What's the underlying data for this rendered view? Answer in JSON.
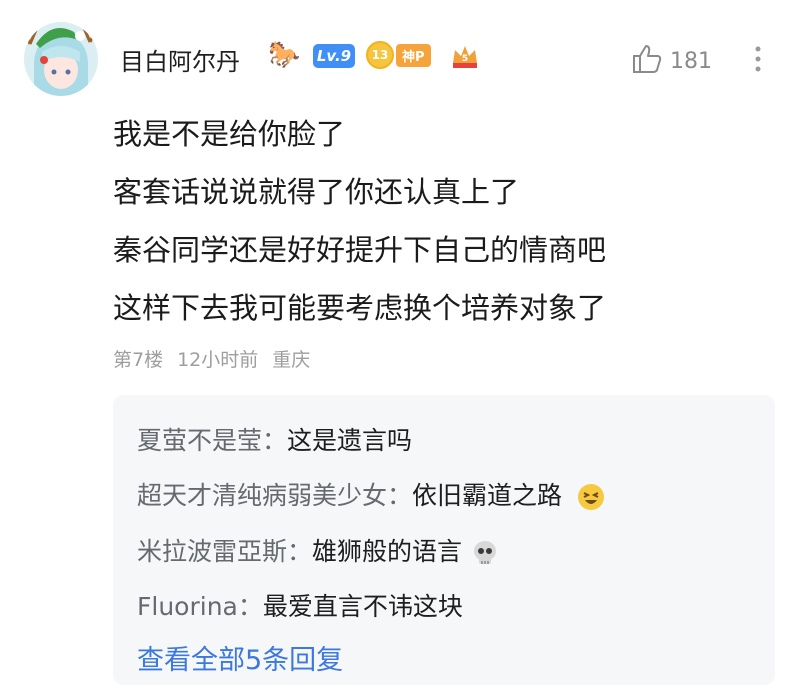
{
  "comment": {
    "username": "目白阿尔丹",
    "level_badge": "Lv.9",
    "medal_level": "13",
    "medal_label": "神P",
    "like_count": "181",
    "lines": [
      "我是不是给你脸了",
      "客套话说说就得了你还认真上了",
      "秦谷同学还是好好提升下自己的情商吧",
      "这样下去我可能要考虑换个培养对象了"
    ],
    "floor": "第7楼",
    "time": "12小时前",
    "location": "重庆"
  },
  "replies": [
    {
      "name": "夏萤不是莹",
      "text": "这是遗言吗",
      "emoji": ""
    },
    {
      "name": "超天才清纯病弱美少女",
      "text": "依旧霸道之路",
      "emoji": "laughing-face-icon"
    },
    {
      "name": "米拉波雷亞斯",
      "text": "雄狮般的语言",
      "emoji": "skull-icon"
    },
    {
      "name": "Fluorina",
      "text": "最爱直言不讳这块",
      "emoji": ""
    }
  ],
  "view_all": "查看全部5条回复",
  "icons": [
    "avatar",
    "horse-icon",
    "crown-icon",
    "thumbs-up-icon",
    "more-vertical-icon"
  ]
}
